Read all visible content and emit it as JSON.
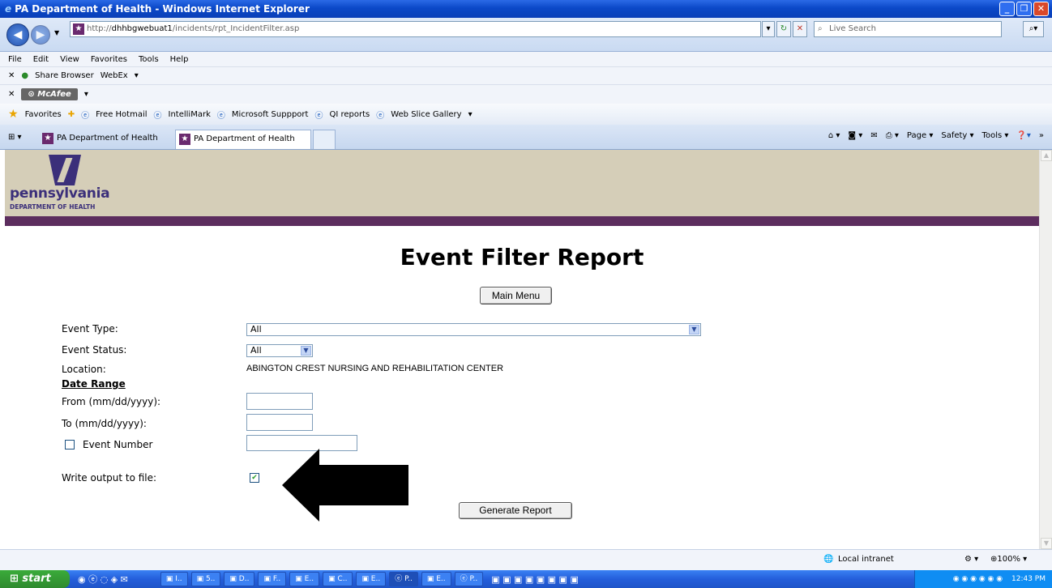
{
  "window": {
    "title": "PA Department of Health - Windows Internet Explorer"
  },
  "address": {
    "prefix": "http://",
    "host": "dhhbgwebuat1",
    "path": "/incidents/rpt_IncidentFilter.asp"
  },
  "search": {
    "placeholder": "Live Search"
  },
  "menu": [
    "File",
    "Edit",
    "View",
    "Favorites",
    "Tools",
    "Help"
  ],
  "toolbar1": {
    "share": "Share Browser",
    "webex": "WebEx"
  },
  "toolbar2": {
    "mcafee": "McAfee"
  },
  "favorites": {
    "label": "Favorites",
    "links": [
      "Free Hotmail",
      "IntelliMark",
      "Microsoft Suppport",
      "QI reports",
      "Web Slice Gallery"
    ]
  },
  "tabs": [
    "PA Department of Health",
    "PA Department of Health"
  ],
  "ietools": [
    "Page",
    "Safety",
    "Tools"
  ],
  "logo": {
    "name": "pennsylvania",
    "sub": "DEPARTMENT OF HEALTH"
  },
  "page": {
    "title": "Event Filter Report",
    "main_menu": "Main Menu",
    "event_type_label": "Event Type:",
    "event_type_value": "All",
    "event_status_label": "Event Status:",
    "event_status_value": "All",
    "location_label": "Location:",
    "location_value": "ABINGTON CREST NURSING AND REHABILITATION CENTER",
    "date_range": "Date Range",
    "from_label": "From (mm/dd/yyyy):",
    "to_label": "To (mm/dd/yyyy):",
    "event_number_label": "Event Number",
    "write_output_label": "Write output to file:",
    "write_output_checked": true,
    "generate": "Generate Report"
  },
  "status": {
    "zone": "Local intranet",
    "zoom": "100%"
  },
  "taskbar": {
    "start": "start",
    "clock": "12:43 PM"
  }
}
